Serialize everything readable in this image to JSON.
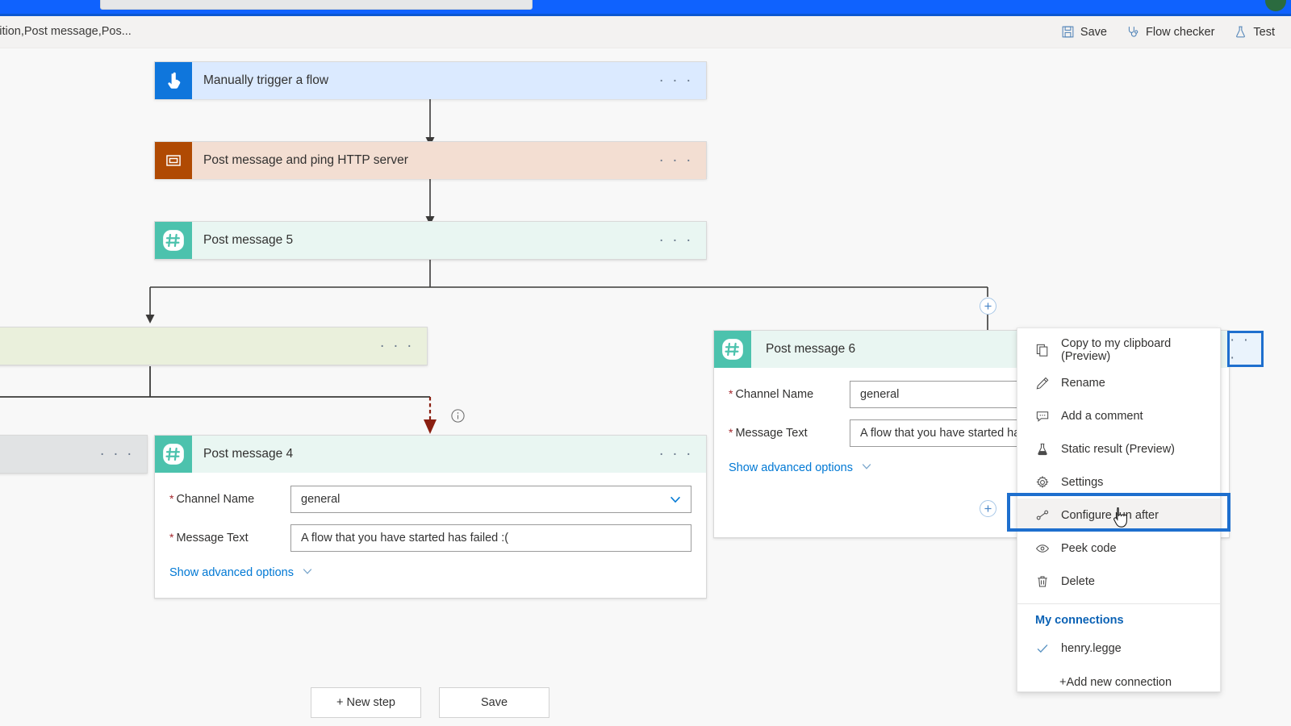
{
  "topbar": {
    "search_placeholder": "",
    "avatar_label": ""
  },
  "commandbar": {
    "breadcrumb": "lition,Post message,Pos...",
    "actions": [
      {
        "label": "Save",
        "icon": "save-icon"
      },
      {
        "label": "Flow checker",
        "icon": "stethoscope-icon"
      },
      {
        "label": "Test",
        "icon": "flask-icon"
      }
    ]
  },
  "flow": {
    "trigger": {
      "title": "Manually trigger a flow",
      "ellipsis": "· · ·"
    },
    "scope": {
      "title": "Post message and ping HTTP server",
      "ellipsis": "· · ·"
    },
    "post5": {
      "title": "Post message 5",
      "ellipsis": "· · ·"
    },
    "olive_card": {
      "title": "",
      "ellipsis": "· · ·"
    },
    "gray_card": {
      "title": "",
      "ellipsis": "· · ·"
    },
    "post4": {
      "title": "Post message 4",
      "ellipsis": "· · ·",
      "fields": [
        {
          "required": "*",
          "label": "Channel Name",
          "value": "general",
          "control": "dropdown"
        },
        {
          "required": "*",
          "label": "Message Text",
          "value": "A flow that you have started has failed :(",
          "control": "text"
        }
      ],
      "advanced_label": "Show advanced options"
    },
    "post6": {
      "title": "Post message 6",
      "fields": [
        {
          "required": "*",
          "label": "Channel Name",
          "value": "general",
          "control": "dropdown"
        },
        {
          "required": "*",
          "label": "Message Text",
          "value": "A flow that you have started has",
          "control": "text"
        }
      ],
      "advanced_label": "Show advanced options",
      "ellipsis": "· · ·"
    }
  },
  "bottom_buttons": [
    {
      "label": "+ New step"
    },
    {
      "label": "Save"
    }
  ],
  "context_menu": {
    "items": [
      {
        "label": "Copy to my clipboard (Preview)",
        "icon": "copy-icon"
      },
      {
        "label": "Rename",
        "icon": "pencil-icon"
      },
      {
        "label": "Add a comment",
        "icon": "comment-icon"
      },
      {
        "label": "Static result (Preview)",
        "icon": "flask-icon"
      },
      {
        "label": "Settings",
        "icon": "gear-icon"
      },
      {
        "label": "Configure run after",
        "icon": "run-after-icon",
        "highlighted": true
      },
      {
        "label": "Peek code",
        "icon": "eye-icon"
      },
      {
        "label": "Delete",
        "icon": "trash-icon"
      }
    ],
    "connections_header": "My connections",
    "connection": {
      "label": "henry.legge",
      "icon": "check-icon"
    },
    "add_connection": "+Add new connection"
  },
  "colors": {
    "accent_blue": "#0078d4",
    "highlight_blue": "#1e6fce",
    "trigger_header": "#dbeaff",
    "trigger_icon": "#0f76dc",
    "http_header": "#f3ded2",
    "http_icon": "#b04a03",
    "teams_header": "#e9f6f2",
    "teams_icon": "#4cc2ad",
    "condition_header": "#eaf0dc",
    "gray_header": "#e1e3e4",
    "failure_arrow": "#8a1f11",
    "required_red": "#a4262c"
  }
}
